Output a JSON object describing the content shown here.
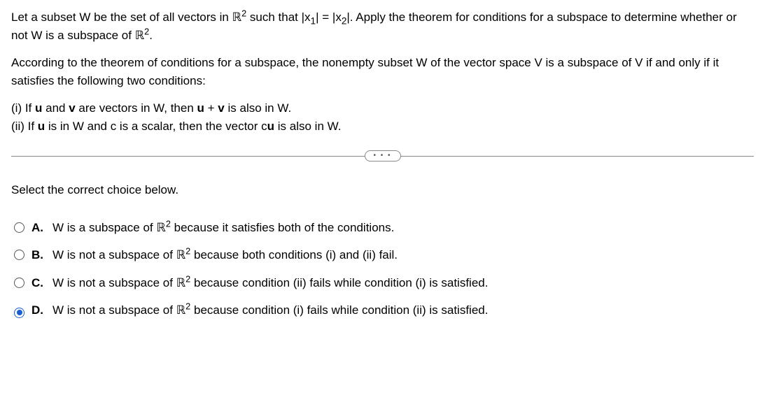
{
  "question": {
    "part1": "Let a subset W be the set of all vectors in ",
    "r2_a": "ℝ",
    "sup2_a": "2",
    "part2": " such that ",
    "abs_x1_open": "|",
    "x1": "x",
    "x1_sub": "1",
    "abs_x1_close": "|",
    "equals": " = ",
    "abs_x2_open": "|",
    "x2": "x",
    "x2_sub": "2",
    "abs_x2_close": "|",
    "part3": ". Apply the theorem for conditions for a subspace to determine whether or not W is a subspace of ",
    "r2_b": "ℝ",
    "sup2_b": "2",
    "period": "."
  },
  "theorem": "According to the theorem of conditions for a subspace, the nonempty subset W of the vector space V is a subspace of V if and only if it satisfies the following two conditions:",
  "cond_i": {
    "prefix": "(i) If ",
    "u1": "u",
    "mid1": " and ",
    "v1": "v",
    "mid2": " are vectors in W, then ",
    "u2": "u",
    "plus": " + ",
    "v2": "v",
    "suffix": " is also in W."
  },
  "cond_ii": {
    "prefix": "(ii) If ",
    "u1": "u",
    "mid1": " is in W and c is a scalar, then the vector c",
    "u2": "u",
    "suffix": " is also in W."
  },
  "divider_dots": "• • •",
  "prompt": "Select the correct choice below.",
  "options": {
    "a": {
      "letter": "A.",
      "pre": "W is a subspace of ",
      "r": "ℝ",
      "sup": "2",
      "post": " because it satisfies both of the conditions."
    },
    "b": {
      "letter": "B.",
      "pre": "W is not a subspace of ",
      "r": "ℝ",
      "sup": "2",
      "post": " because both conditions (i) and (ii) fail."
    },
    "c": {
      "letter": "C.",
      "pre": "W is not a subspace of ",
      "r": "ℝ",
      "sup": "2",
      "post": " because condition (ii) fails while condition (i) is satisfied."
    },
    "d": {
      "letter": "D.",
      "pre": "W is not a subspace of ",
      "r": "ℝ",
      "sup": "2",
      "post": " because condition (i) fails while condition (ii) is satisfied."
    }
  },
  "selected": "d"
}
